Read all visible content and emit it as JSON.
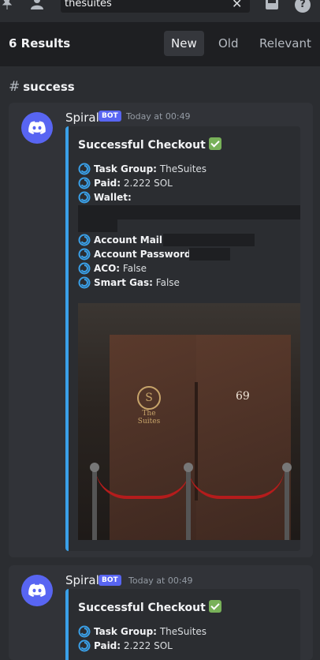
{
  "topbar": {
    "search_value": "thesuites",
    "icons": [
      "pin-icon",
      "members-icon",
      "clear-icon",
      "inbox-icon",
      "help-icon"
    ],
    "help_glyph": "?"
  },
  "results_header": {
    "count": "6 Results",
    "tabs": [
      {
        "label": "New",
        "active": true
      },
      {
        "label": "Old",
        "active": false
      },
      {
        "label": "Relevant",
        "active": false
      }
    ]
  },
  "channel": {
    "name": "success"
  },
  "messages": [
    {
      "author": "Spiral",
      "badge": "BOT",
      "timestamp": "Today at 00:49",
      "embed": {
        "title": "Successful Checkout",
        "fields": [
          {
            "label": "Task Group:",
            "value": "TheSuites"
          },
          {
            "label": "Paid:",
            "value": "2.222 SOL"
          },
          {
            "label": "Wallet:",
            "value": ""
          },
          {
            "label": "Account Mail:",
            "value": ""
          },
          {
            "label": "Account Password:",
            "value": ""
          },
          {
            "label": "ACO:",
            "value": "False"
          },
          {
            "label": "Smart Gas:",
            "value": "False"
          }
        ],
        "image": {
          "door_number": "69",
          "brand": "The Suites"
        }
      }
    },
    {
      "author": "Spiral",
      "badge": "BOT",
      "timestamp": "Today at 00:49",
      "embed": {
        "title": "Successful Checkout",
        "fields": [
          {
            "label": "Task Group:",
            "value": "TheSuites"
          },
          {
            "label": "Paid:",
            "value": "2.222 SOL"
          }
        ]
      }
    }
  ],
  "colors": {
    "accent": "#5865f2",
    "embed_border": "#3aa0e8",
    "rope": "#b51c1c"
  }
}
